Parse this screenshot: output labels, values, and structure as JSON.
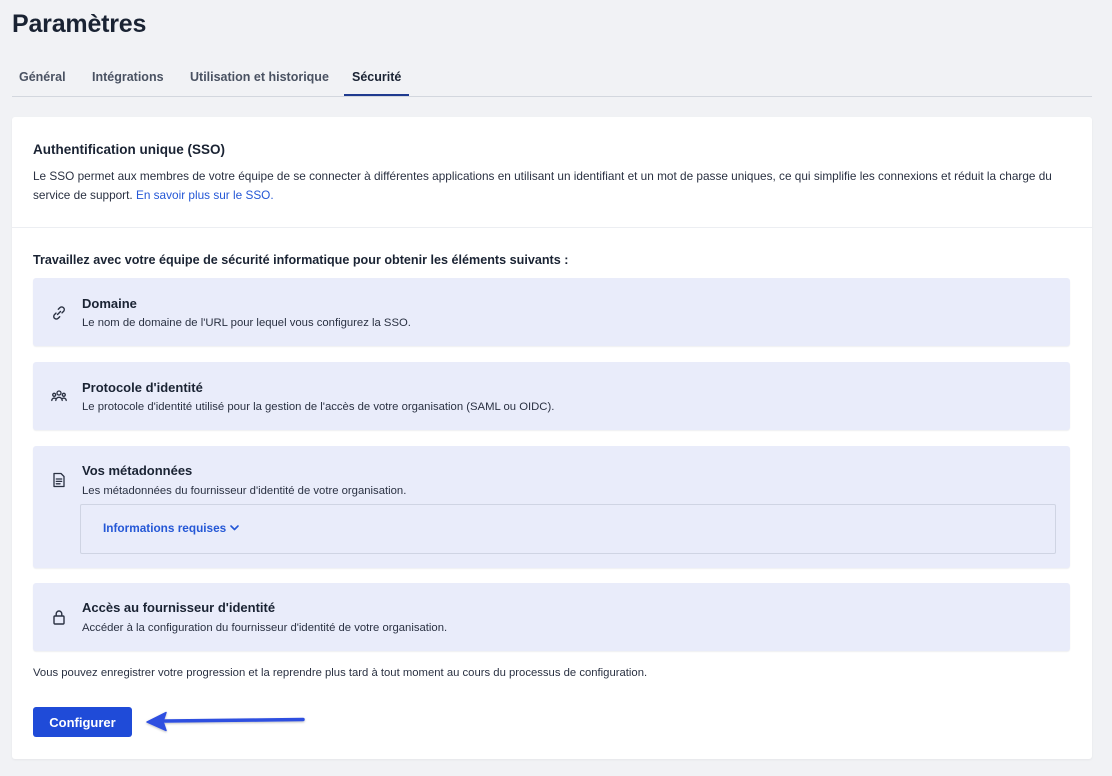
{
  "page_title": "Paramètres",
  "tabs": [
    {
      "label": "Général",
      "active": false
    },
    {
      "label": "Intégrations",
      "active": false
    },
    {
      "label": "Utilisation et historique",
      "active": false
    },
    {
      "label": "Sécurité",
      "active": true
    }
  ],
  "sso": {
    "title": "Authentification unique (SSO)",
    "description": "Le SSO permet aux membres de votre équipe de se connecter à différentes applications en utilisant un identifiant et un mot de passe uniques, ce qui simplifie les connexions et réduit la charge du service de support.",
    "learn_more_link": "En savoir plus sur le SSO."
  },
  "requirements": {
    "title": "Travaillez avec votre équipe de sécurité informatique pour obtenir les éléments suivants :",
    "items": [
      {
        "icon": "link-icon",
        "title": "Domaine",
        "description": "Le nom de domaine de l'URL pour lequel vous configurez la SSO."
      },
      {
        "icon": "users-icon",
        "title": "Protocole d'identité",
        "description": "Le protocole d'identité utilisé pour la gestion de l'accès de votre organisation (SAML ou OIDC)."
      },
      {
        "icon": "document-icon",
        "title": "Vos métadonnées",
        "description": "Les métadonnées du fournisseur d'identité de votre organisation.",
        "expander_label": "Informations requises"
      },
      {
        "icon": "lock-icon",
        "title": "Accès au fournisseur d'identité",
        "description": "Accéder à la configuration du fournisseur d'identité de votre organisation."
      }
    ]
  },
  "save_note": "Vous pouvez enregistrer votre progression et la reprendre plus tard à tout moment au cours du processus de configuration.",
  "configure_button": "Configurer",
  "colors": {
    "accent": "#1f4bd8",
    "link": "#2457d6",
    "item_background": "#e9ecfa",
    "page_background": "#f1f2f5",
    "annotation_arrow": "#2f4fe0"
  }
}
